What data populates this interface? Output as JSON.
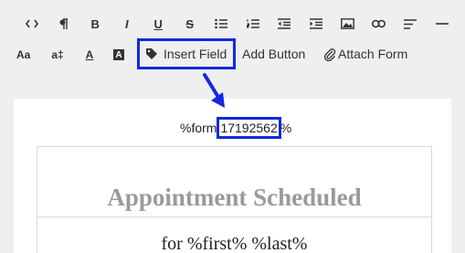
{
  "toolbar": {
    "row1": [
      {
        "name": "code-view-icon",
        "glyph": "<>"
      },
      {
        "name": "paragraph-icon",
        "glyph": "¶"
      },
      {
        "name": "bold-icon",
        "glyph": "B"
      },
      {
        "name": "italic-icon",
        "glyph": "I"
      },
      {
        "name": "underline-icon",
        "glyph": "U"
      },
      {
        "name": "strikethrough-icon",
        "glyph": "S"
      },
      {
        "name": "bulleted-list-icon",
        "glyph": ""
      },
      {
        "name": "numbered-list-icon",
        "glyph": ""
      },
      {
        "name": "outdent-icon",
        "glyph": ""
      },
      {
        "name": "indent-icon",
        "glyph": ""
      },
      {
        "name": "image-icon",
        "glyph": ""
      },
      {
        "name": "link-icon",
        "glyph": ""
      },
      {
        "name": "align-icon",
        "glyph": ""
      },
      {
        "name": "horizontal-rule-icon",
        "glyph": ""
      }
    ],
    "font_size_label": "Aa",
    "line_height_label": "a‡",
    "font_color_label": "A",
    "background_color_label": "A",
    "insert_field_label": "Insert Field",
    "add_button_label": "Add Button",
    "attach_form_label": "Attach Form",
    "highlight_color": "#1428e0"
  },
  "editor": {
    "form_prefix": "%form",
    "form_id": "17192562",
    "form_suffix": "%",
    "card_title": "Appointment Scheduled",
    "card_subtitle": "for %first% %last%"
  }
}
